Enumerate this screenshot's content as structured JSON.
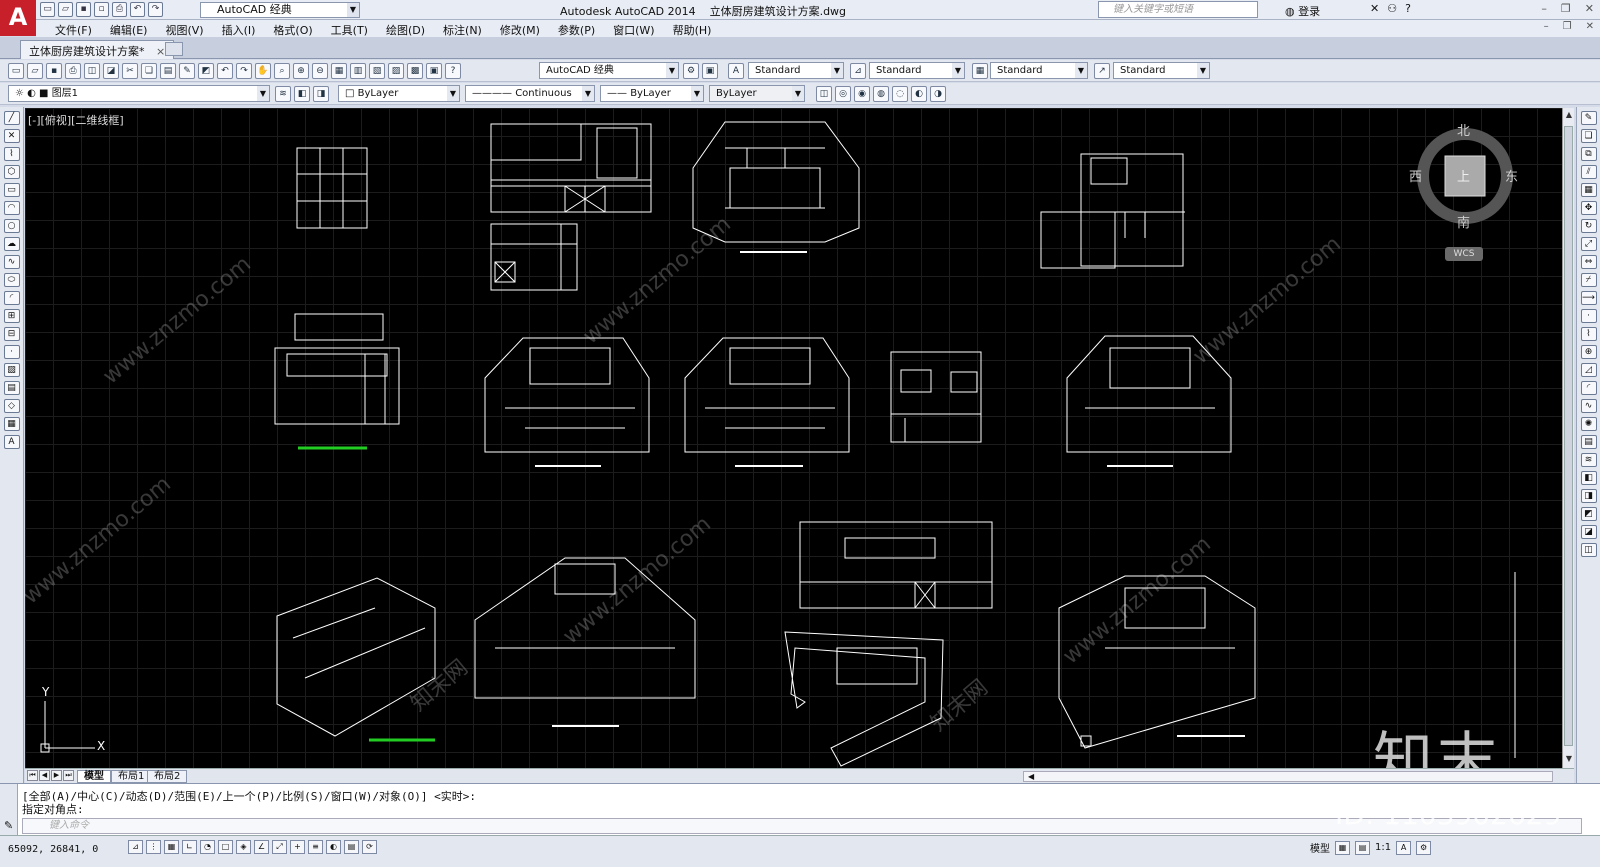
{
  "app": {
    "logo_letter": "A",
    "workspace": "AutoCAD 经典",
    "window_title": "Autodesk AutoCAD 2014    立体厨房建筑设计方案.dwg",
    "search_placeholder": "键入关键字或短语",
    "login_label": "登录"
  },
  "menu": [
    "文件(F)",
    "编辑(E)",
    "视图(V)",
    "插入(I)",
    "格式(O)",
    "工具(T)",
    "绘图(D)",
    "标注(N)",
    "修改(M)",
    "参数(P)",
    "窗口(W)",
    "帮助(H)"
  ],
  "tabs": {
    "active_doc": "立体厨房建筑设计方案*",
    "close_glyph": "×"
  },
  "toolbar": {
    "workspace_combo": "AutoCAD 经典",
    "text_style": "Standard",
    "dim_style": "Standard",
    "table_style": "Standard",
    "mleader_style": "Standard",
    "layer": "图层1",
    "color": "ByLayer",
    "linetype": "Continuous",
    "lineweight": "ByLayer",
    "plotstyle": "ByLayer"
  },
  "viewport": {
    "label": "[-][俯视][二维线框]",
    "compass": {
      "north": "北",
      "south": "南",
      "east": "东",
      "west": "西",
      "top": "上"
    },
    "wcs": "WCS",
    "ucs_x": "X",
    "ucs_y": "Y"
  },
  "layout_tabs": [
    "模型",
    "布局1",
    "布局2"
  ],
  "command": {
    "line1": "[全部(A)/中心(C)/动态(D)/范围(E)/上一个(P)/比例(S)/窗口(W)/对象(O)] <实时>:",
    "line2": "指定对角点:",
    "input_placeholder": "键入命令"
  },
  "status": {
    "coordinates": "65092, 26841, 0",
    "model_label": "模型",
    "scale": "1:1"
  },
  "watermarks": {
    "site": "www.znzmo.com",
    "site_cn": "知末网",
    "logo": "知末",
    "id": "ID: 1103902629"
  },
  "colors": {
    "canvas": "#000000",
    "linework": "#ffffff",
    "highlight": "#22cc22",
    "logo_red": "#c8202a"
  }
}
